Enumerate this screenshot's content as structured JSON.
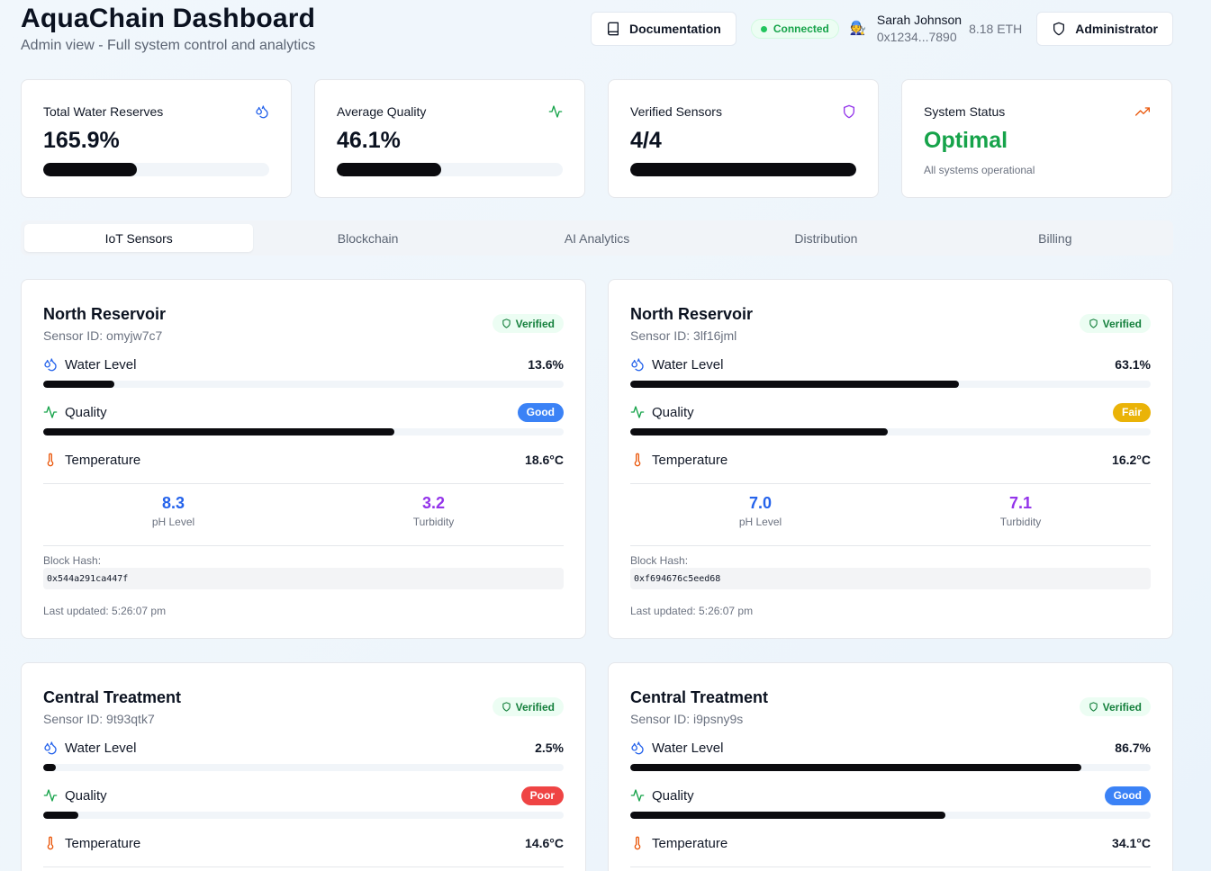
{
  "header": {
    "title": "AquaChain Dashboard",
    "subtitle": "Admin view - Full system control and analytics",
    "documentation_label": "Documentation",
    "connection_status": "Connected",
    "user_name": "Sarah Johnson",
    "user_address": "0x1234...7890",
    "balance": "8.18 ETH",
    "role_label": "Administrator",
    "avatar_icon": "person-icon"
  },
  "stats": [
    {
      "label": "Total Water Reserves",
      "value": "165.9%",
      "progress": 0.415,
      "icon": "droplets-icon",
      "icon_color": "#2563eb"
    },
    {
      "label": "Average Quality",
      "value": "46.1%",
      "progress": 0.461,
      "icon": "activity-icon",
      "icon_color": "#16a34a"
    },
    {
      "label": "Verified Sensors",
      "value": "4/4",
      "progress": 1.0,
      "icon": "shield-icon",
      "icon_color": "#9333ea"
    },
    {
      "label": "System Status",
      "value": "Optimal",
      "sub": "All systems operational",
      "icon": "trending-up-icon",
      "icon_color": "#ea580c"
    }
  ],
  "tabs": [
    {
      "label": "IoT Sensors",
      "active": true
    },
    {
      "label": "Blockchain",
      "active": false
    },
    {
      "label": "AI Analytics",
      "active": false
    },
    {
      "label": "Distribution",
      "active": false
    },
    {
      "label": "Billing",
      "active": false
    }
  ],
  "sensor_labels": {
    "water_level": "Water Level",
    "quality": "Quality",
    "temperature": "Temperature",
    "ph": "pH Level",
    "turbidity": "Turbidity",
    "block_hash": "Block Hash:",
    "verified": "Verified"
  },
  "sensors": [
    {
      "name": "North Reservoir",
      "sensor_id": "Sensor ID: omyjw7c7",
      "water_level": "13.6%",
      "water_progress": 0.136,
      "quality_label": "Good",
      "quality_progress": 0.675,
      "temperature": "18.6°C",
      "ph": "8.3",
      "turbidity": "3.2",
      "block_hash": "0x544a291ca447f",
      "last_updated": "Last updated: 5:26:07 pm"
    },
    {
      "name": "North Reservoir",
      "sensor_id": "Sensor ID: 3lf16jml",
      "water_level": "63.1%",
      "water_progress": 0.631,
      "quality_label": "Fair",
      "quality_progress": 0.495,
      "temperature": "16.2°C",
      "ph": "7.0",
      "turbidity": "7.1",
      "block_hash": "0xf694676c5eed68",
      "last_updated": "Last updated: 5:26:07 pm"
    },
    {
      "name": "Central Treatment",
      "sensor_id": "Sensor ID: 9t93qtk7",
      "water_level": "2.5%",
      "water_progress": 0.025,
      "quality_label": "Poor",
      "quality_progress": 0.068,
      "temperature": "14.6°C",
      "ph": "",
      "turbidity": "",
      "block_hash": "",
      "last_updated": ""
    },
    {
      "name": "Central Treatment",
      "sensor_id": "Sensor ID: i9psny9s",
      "water_level": "86.7%",
      "water_progress": 0.867,
      "quality_label": "Good",
      "quality_progress": 0.606,
      "temperature": "34.1°C",
      "ph": "",
      "turbidity": "",
      "block_hash": "",
      "last_updated": ""
    }
  ],
  "colors": {
    "good": "#3b82f6",
    "fair": "#eab308",
    "poor": "#ef4444",
    "accent_green": "#16a34a"
  }
}
